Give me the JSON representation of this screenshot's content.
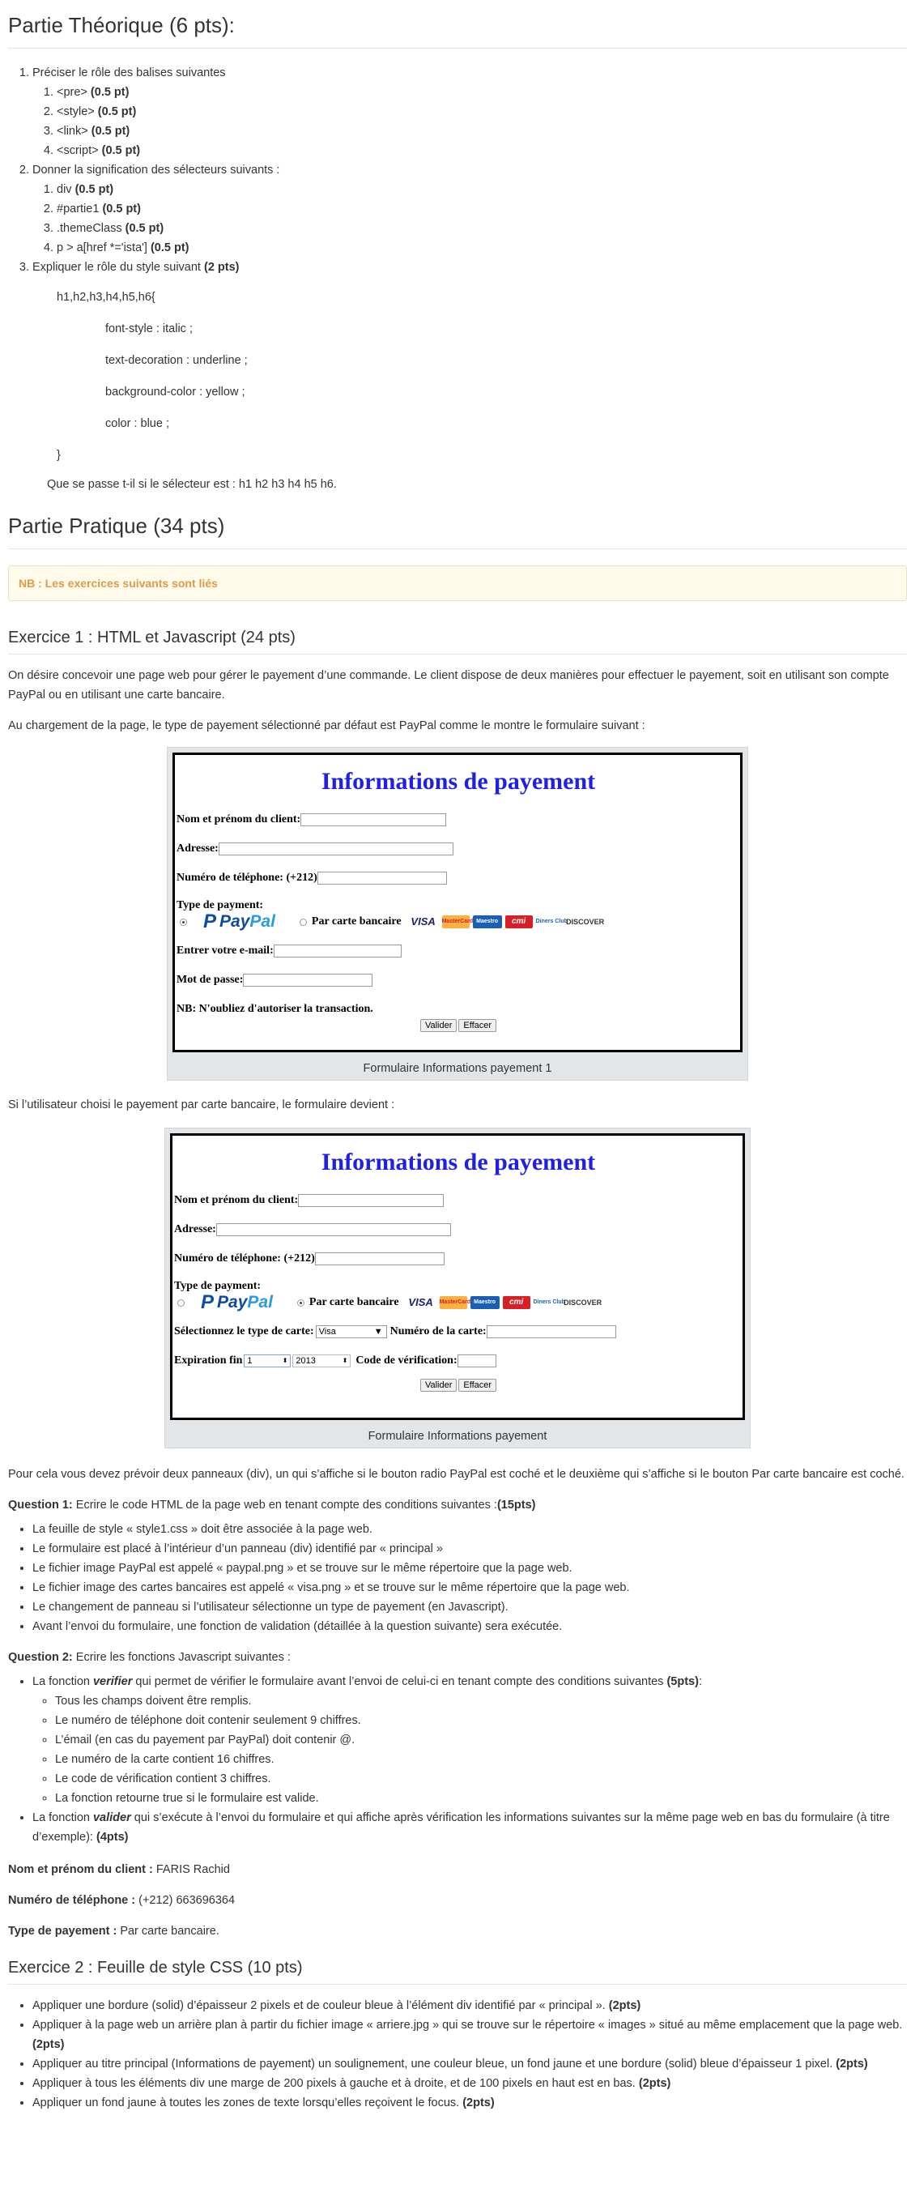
{
  "theory": {
    "title": "Partie Théorique  (6 pts):",
    "items": [
      {
        "text": "Préciser le rôle des balises suivantes",
        "sub": [
          {
            "text": "<pre> ",
            "pts": "(0.5 pt)"
          },
          {
            "text": "<style> ",
            "pts": "(0.5 pt)"
          },
          {
            "text": "<link> ",
            "pts": "(0.5 pt)"
          },
          {
            "text": "<script> ",
            "pts": "(0.5 pt)"
          }
        ]
      },
      {
        "text": "Donner la signification des sélecteurs suivants :",
        "sub": [
          {
            "text": "div ",
            "pts": "(0.5 pt)"
          },
          {
            "text": "#partie1 ",
            "pts": "(0.5 pt)"
          },
          {
            "text": ".themeClass ",
            "pts": "(0.5 pt)"
          },
          {
            "text": "p > a[href *='ista'] ",
            "pts": "(0.5 pt)"
          }
        ]
      },
      {
        "text": "Expliquer le rôle du style suivant ",
        "pts": "(2 pts)"
      }
    ],
    "code": {
      "open": "h1,h2,h3,h4,h5,h6{",
      "lines": [
        "font-style : italic ;",
        "text-decoration : underline ;",
        "background-color : yellow ;",
        "color : blue ;"
      ],
      "close": "}"
    },
    "question": "Que se passe t-il si le sélecteur est : h1 h2 h3 h4 h5 h6."
  },
  "practice": {
    "title": "Partie Pratique (34 pts)",
    "nb": "NB : Les exercices suivants sont liés"
  },
  "ex1": {
    "title": "Exercice 1 : HTML et Javascript (24 pts)",
    "intro": "On désire concevoir une page web pour gérer le payement d’une commande. Le client dispose de deux manières pour effectuer le payement, soit en utilisant son compte PayPal ou en utilisant une carte bancaire.",
    "loading": "Au chargement de la page, le type de payement sélectionné par défaut est PayPal comme le montre le formulaire suivant :",
    "form1": {
      "title": "Informations de payement",
      "name_label": "Nom et prénom du client:",
      "address_label": "Adresse:",
      "phone_label": "Numéro de téléphone: (+212)",
      "type_label": "Type de payment:",
      "paypal_a": "Pay",
      "paypal_b": "Pal",
      "card_option": "Par carte bancaire",
      "email_label": "Entrer votre e-mail:",
      "password_label": "Mot de passe:",
      "nb": "NB: N'oubliez d'autoriser la transaction.",
      "validate": "Valider",
      "reset": "Effacer",
      "caption": "Formulaire Informations payement 1"
    },
    "card_logos": {
      "visa": "VISA",
      "mc": "MasterCard",
      "maestro": "Maestro",
      "cmi": "cmi",
      "dc": "Diners Club",
      "discover": "DISCOVER"
    },
    "switch_text": " Si l’utilisateur choisi le payement par carte bancaire, le formulaire devient :",
    "form2": {
      "title": "Informations de payement",
      "name_label": "Nom et prénom du client:",
      "address_label": "Adresse:",
      "phone_label": "Numéro de téléphone: (+212)",
      "type_label": "Type de payment:",
      "card_option": "Par carte bancaire",
      "card_type_label": "Sélectionnez le type de carte:",
      "card_type_value": "Visa",
      "card_number_label": "Numéro de la carte:",
      "expiry_label": "Expiration fin",
      "month_value": "1",
      "year_value": "2013",
      "cvv_label": "Code de vérification:",
      "validate": "Valider",
      "reset": "Effacer",
      "caption": "Formulaire Informations payement"
    },
    "panels_text": "Pour cela vous devez prévoir deux panneaux (div), un qui s’affiche si le bouton radio PayPal est coché et le deuxième qui s’affiche si le bouton Par carte bancaire est coché.",
    "q1": {
      "label": "Question 1:",
      "text": " Ecrire le code HTML de la page web en tenant compte des conditions suivantes :",
      "pts": "(15pts)",
      "items": [
        "La feuille de style « style1.css » doit être associée à la page web.",
        "Le formulaire est placé à l’intérieur d’un panneau (div) identifié par « principal »",
        "Le fichier image PayPal est appelé « paypal.png » et se trouve sur le même répertoire que la page web.",
        "Le fichier image des cartes bancaires est appelé « visa.png » et se trouve sur le même répertoire que la page web.",
        "Le changement de panneau si l’utilisateur sélectionne un type de payement (en Javascript).",
        "Avant l’envoi du formulaire, une fonction de validation (détaillée à la question suivante) sera exécutée."
      ]
    },
    "q2": {
      "label": "Question 2:",
      "text": " Ecrire les fonctions Javascript suivantes :",
      "verif_a": "La fonction ",
      "verif_fn": "verifier",
      "verif_b": " qui permet de vérifier le formulaire avant l’envoi de celui-ci en tenant compte des conditions suivantes ",
      "verif_pts": "(5pts)",
      "verif_end": ":",
      "verif_items": [
        "Tous les champs doivent être remplis.",
        "Le numéro de téléphone doit contenir seulement 9 chiffres.",
        "L’émail (en cas du payement par PayPal) doit contenir @.",
        "Le numéro de la carte contient 16 chiffres.",
        "Le code de vérification contient 3 chiffres.",
        "La fonction retourne true si le formulaire est valide."
      ],
      "valid_a": "La fonction ",
      "valid_fn": "valider",
      "valid_b": " qui s’exécute à l’envoi du formulaire et qui affiche après vérification les informations suivantes sur la même page web en bas du formulaire (à titre d’exemple): ",
      "valid_pts": "(4pts)"
    },
    "sample": {
      "name_label": "Nom et prénom du client :",
      "name_value": " FARIS Rachid",
      "phone_label": "Numéro de téléphone :",
      "phone_value": " (+212) 663696364",
      "type_label": "Type de payement :",
      "type_value": " Par carte bancaire."
    }
  },
  "ex2": {
    "title": "Exercice 2 : Feuille de style CSS (10 pts)",
    "items": [
      {
        "text": "Appliquer une bordure (solid) d’épaisseur 2 pixels et de couleur bleue à l’élément div identifié par « principal ». ",
        "pts": "(2pts)"
      },
      {
        "text": "Appliquer à la page web un arrière plan à partir du fichier image « arriere.jpg » qui se trouve sur le répertoire « images » situé au même emplacement que la page web. ",
        "pts": "(2pts)"
      },
      {
        "text": "Appliquer au titre principal (Informations de payement) un soulignement, une couleur bleue, un fond jaune et une bordure (solid) bleue d’épaisseur 1 pixel. ",
        "pts": "(2pts)"
      },
      {
        "text": "Appliquer à tous les éléments div une marge de 200 pixels à gauche et à droite, et de 100 pixels en haut est en bas. ",
        "pts": "(2pts)"
      },
      {
        "text": "Appliquer un fond jaune à toutes les zones de texte lorsqu’elles reçoivent le focus. ",
        "pts": "(2pts)"
      }
    ]
  }
}
